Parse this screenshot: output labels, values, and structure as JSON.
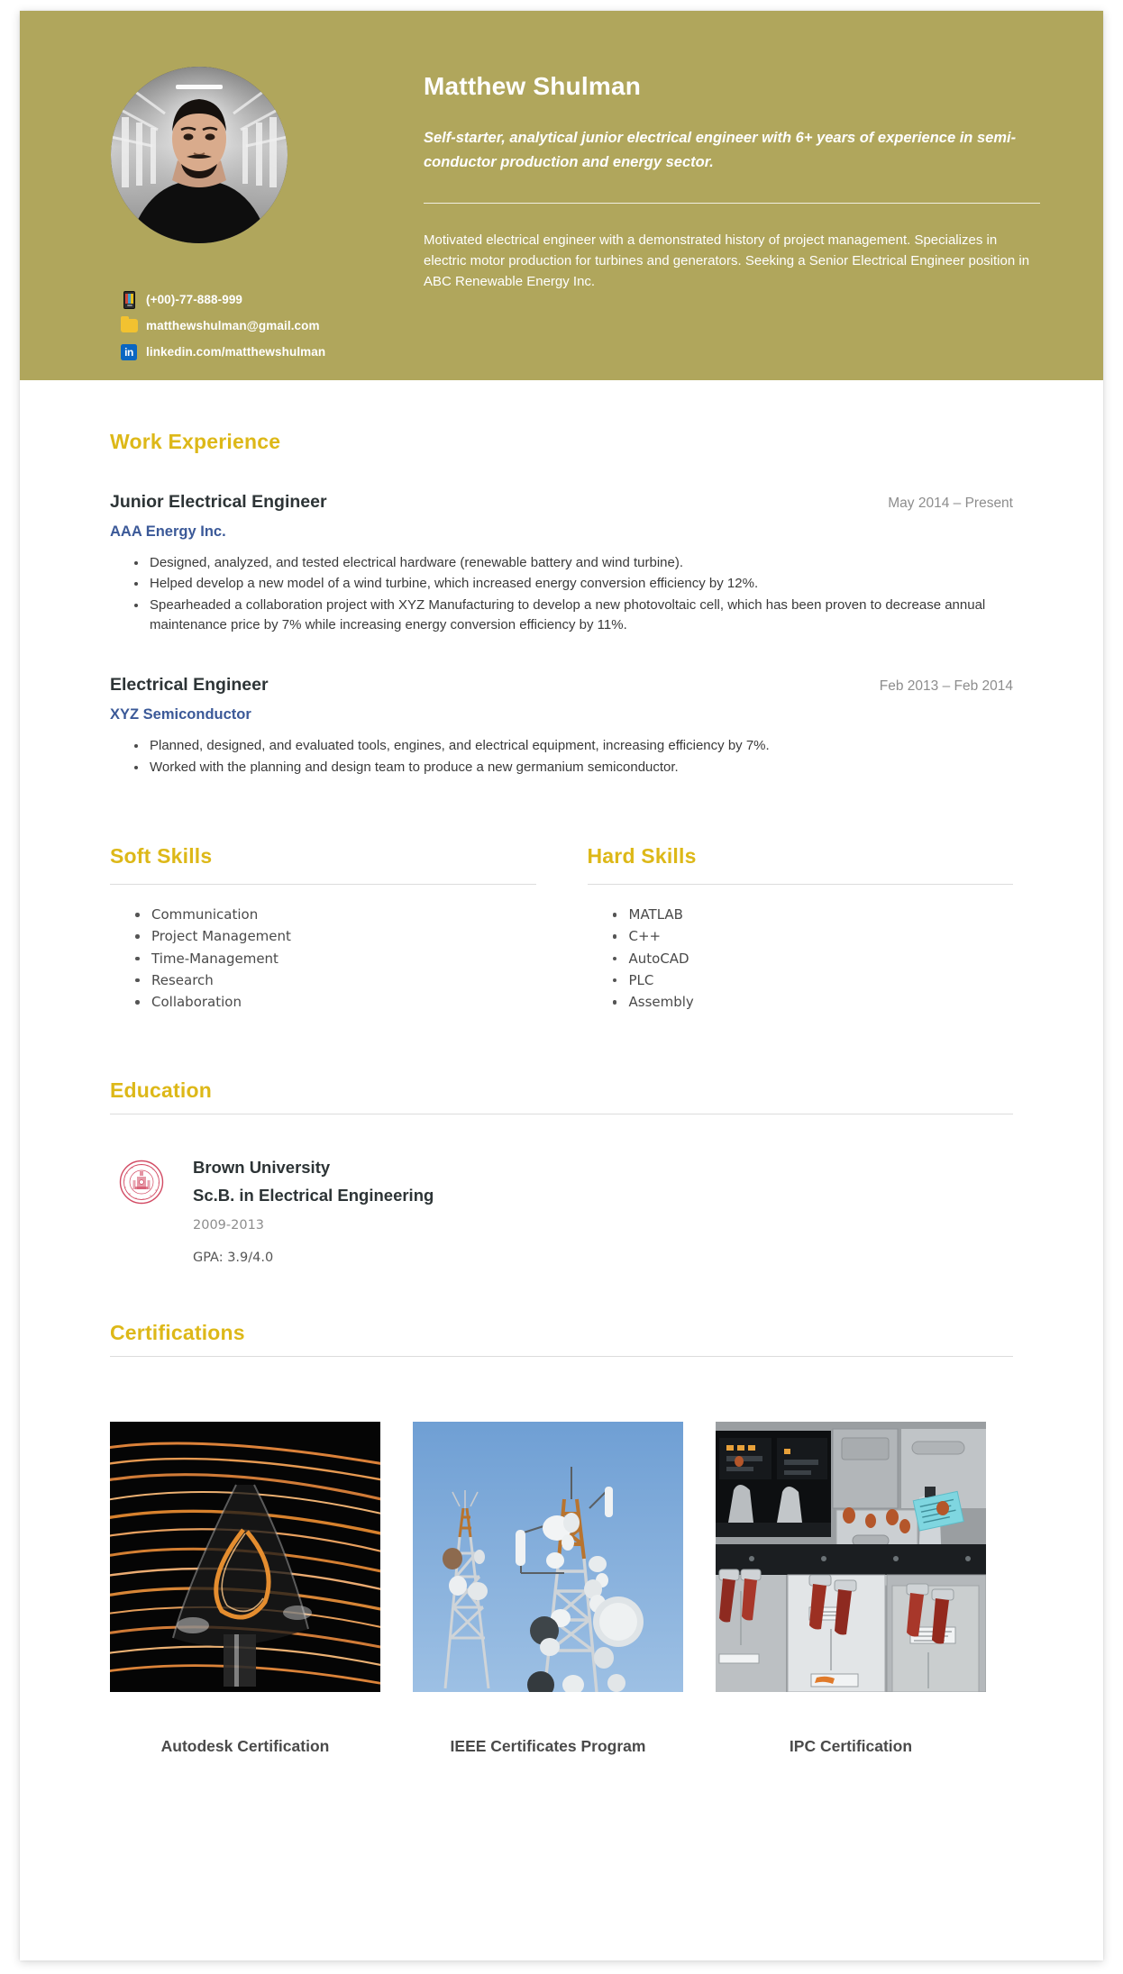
{
  "theme": {
    "header_bg": "#b0a65c",
    "heading_gold": "#ddb818",
    "company_blue": "#3b5998",
    "date_gray": "#8d8d8d",
    "body_text": "#3a3a3a"
  },
  "header": {
    "name": "Matthew Shulman",
    "tagline": "Self-starter, analytical junior electrical engineer with 6+ years of experience in semi-conductor production and energy sector.",
    "summary": "Motivated electrical engineer with a demonstrated history of project management. Specializes in electric motor production for turbines and generators. Seeking a Senior Electrical Engineer position in ABC Renewable Energy Inc.",
    "contacts": [
      {
        "icon": "phone-icon",
        "text": "(+00)-77-888-999"
      },
      {
        "icon": "folder-icon",
        "text": "matthewshulman@gmail.com"
      },
      {
        "icon": "linkedin-icon",
        "text": "linkedin.com/matthewshulman"
      }
    ],
    "linkedin_glyph": "in"
  },
  "work_experience": {
    "title": "Work Experience",
    "jobs": [
      {
        "title": "Junior Electrical Engineer",
        "dates": "May 2014 – Present",
        "company": "AAA Energy Inc.",
        "bullets": [
          "Designed, analyzed, and tested electrical hardware (renewable battery and wind turbine).",
          "Helped develop a new model of a wind turbine, which increased energy conversion efficiency by 12%.",
          "Spearheaded a collaboration project with XYZ Manufacturing to develop a new photovoltaic cell, which has been proven to decrease annual maintenance price by 7% while increasing energy conversion efficiency by 11%."
        ]
      },
      {
        "title": "Electrical Engineer",
        "dates": "Feb 2013 – Feb 2014",
        "company": "XYZ Semiconductor",
        "bullets": [
          "Planned, designed, and evaluated tools, engines, and electrical equipment, increasing efficiency by 7%.",
          "Worked with the planning and design team to produce a new germanium semiconductor."
        ]
      }
    ]
  },
  "soft_skills": {
    "title": "Soft Skills",
    "items": [
      "Communication",
      "Project Management",
      "Time-Management",
      "Research",
      "Collaboration"
    ]
  },
  "hard_skills": {
    "title": "Hard Skills",
    "items": [
      "MATLAB",
      "C++",
      "AutoCAD",
      "PLC",
      "Assembly"
    ]
  },
  "education": {
    "title": "Education",
    "entries": [
      {
        "school": "Brown University",
        "degree": "Sc.B. in Electrical Engineering",
        "years": "2009-2013",
        "gpa": "GPA: 3.9/4.0"
      }
    ]
  },
  "certifications": {
    "title": "Certifications",
    "items": [
      {
        "label": "Autodesk Certification",
        "image": "light-trails-photo"
      },
      {
        "label": "IEEE Certificates Program",
        "image": "telecom-towers-photo"
      },
      {
        "label": "IPC Certification",
        "image": "equipment-panels-photo"
      }
    ]
  }
}
